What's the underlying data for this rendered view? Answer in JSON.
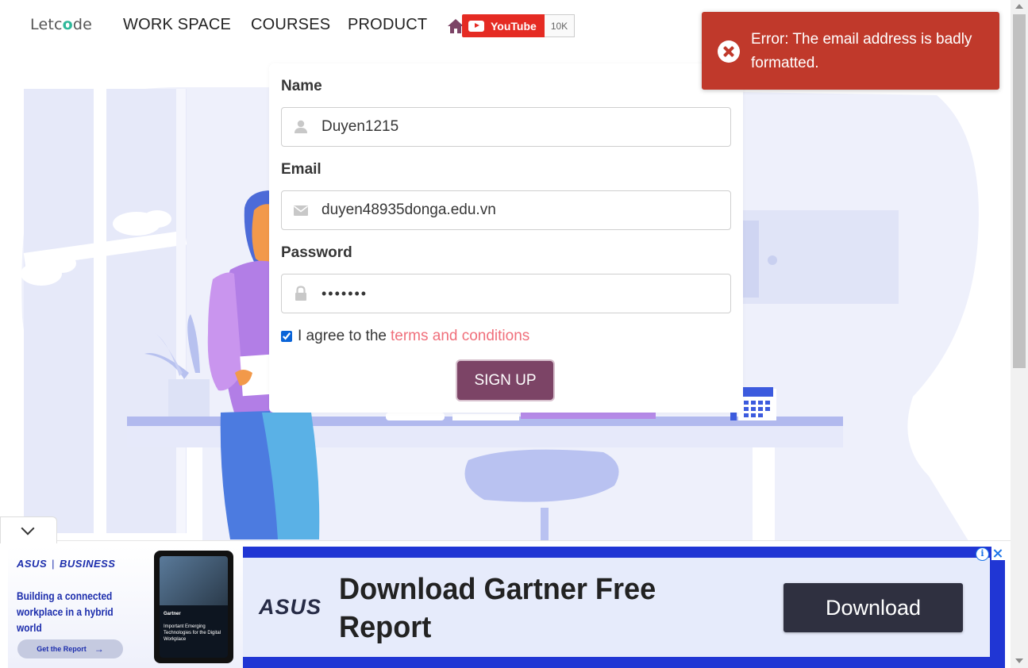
{
  "navbar": {
    "logo": {
      "prefix": "Letc",
      "accent": "o",
      "suffix": "de"
    },
    "links": [
      "WORK SPACE",
      "COURSES",
      "PRODUCT"
    ],
    "youtube": {
      "label": "YouTube",
      "count": "10K"
    }
  },
  "form": {
    "name_label": "Name",
    "name_value": "Duyen1215",
    "email_label": "Email",
    "email_value": "duyen48935donga.edu.vn",
    "password_label": "Password",
    "password_value": "•••••••",
    "agree_text": "I agree to the",
    "terms_link": "terms and conditions",
    "agree_checked": true,
    "signup_label": "SIGN UP"
  },
  "toast": {
    "message": "Error: The email address is badly formatted.",
    "color": "#c0392b"
  },
  "ad": {
    "brand_small": "ASUS",
    "division": "BUSINESS",
    "tagline": "Building a connected workplace in a hybrid world",
    "cta_small": "Get the Report",
    "phone_brand": "Gartner",
    "phone_text": "Important Emerging Technologies for the Digital Workplace",
    "logo": "ASUS",
    "headline": "Download Gartner Free Report",
    "button": "Download"
  },
  "colors": {
    "accent": "#7c4466",
    "link": "#f06f7b",
    "error": "#c0392b",
    "ad_blue": "#2036d4"
  }
}
